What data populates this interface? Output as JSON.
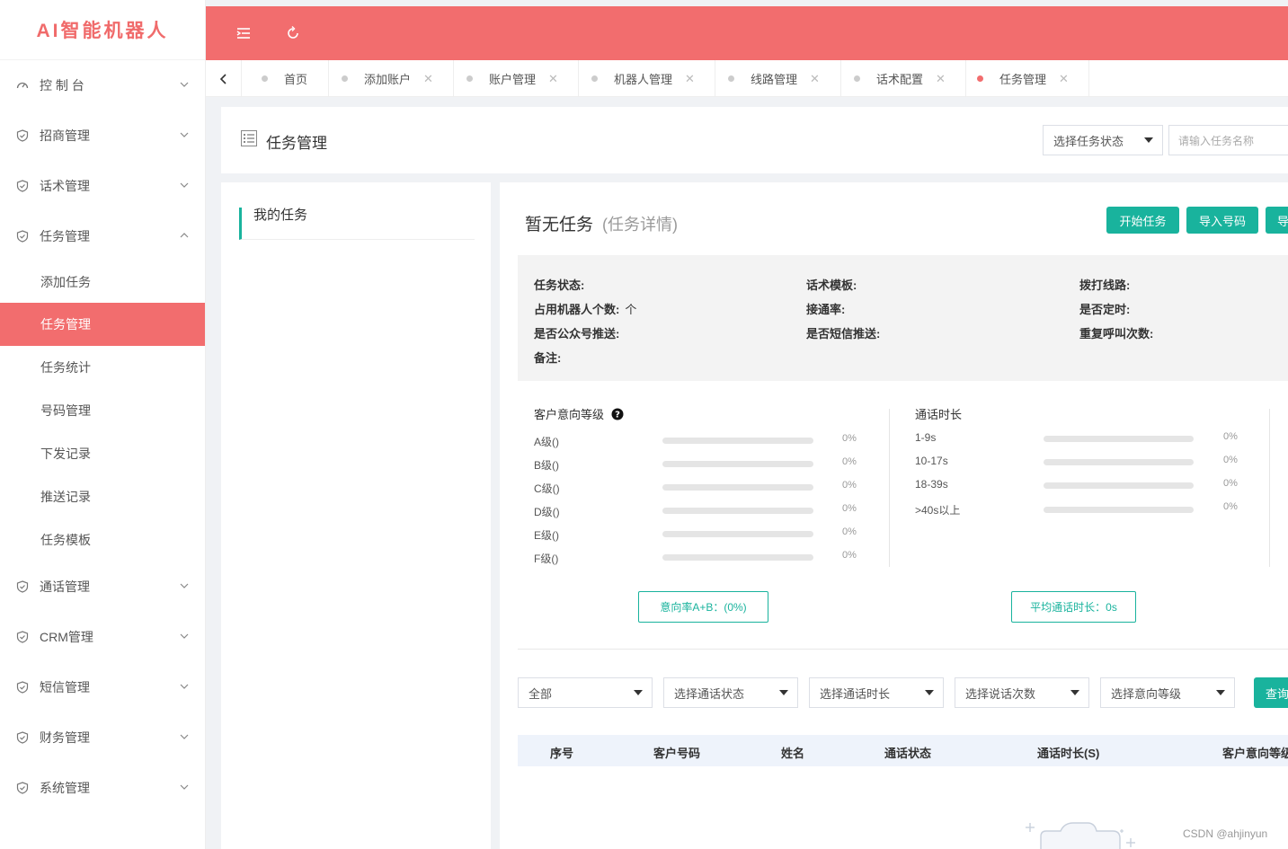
{
  "app": {
    "logo": "AI智能机器人"
  },
  "sidebar": {
    "items": [
      {
        "label": "控 制 台",
        "icon": "dashboard-icon",
        "expanded": false
      },
      {
        "label": "招商管理",
        "icon": "shield-icon",
        "expanded": false
      },
      {
        "label": "话术管理",
        "icon": "shield-icon",
        "expanded": false
      },
      {
        "label": "任务管理",
        "icon": "shield-icon",
        "expanded": true
      },
      {
        "label": "通话管理",
        "icon": "shield-icon",
        "expanded": false
      },
      {
        "label": "CRM管理",
        "icon": "shield-icon",
        "expanded": false
      },
      {
        "label": "短信管理",
        "icon": "shield-icon",
        "expanded": false
      },
      {
        "label": "财务管理",
        "icon": "shield-icon",
        "expanded": false
      },
      {
        "label": "系统管理",
        "icon": "shield-icon",
        "expanded": false
      }
    ],
    "task_sub": [
      "添加任务",
      "任务管理",
      "任务统计",
      "号码管理",
      "下发记录",
      "推送记录",
      "任务模板"
    ]
  },
  "topbar": {
    "menu_icon": "menu-fold-icon",
    "refresh_icon": "refresh-icon"
  },
  "tabs": [
    {
      "label": "首页",
      "closable": false
    },
    {
      "label": "添加账户",
      "closable": true
    },
    {
      "label": "账户管理",
      "closable": true
    },
    {
      "label": "机器人管理",
      "closable": true
    },
    {
      "label": "线路管理",
      "closable": true
    },
    {
      "label": "话术配置",
      "closable": true
    },
    {
      "label": "任务管理",
      "closable": true,
      "active": true
    }
  ],
  "page": {
    "title": "任务管理",
    "status_select": "选择任务状态",
    "name_placeholder": "请输入任务名称"
  },
  "left": {
    "my_tasks": "我的任务"
  },
  "main": {
    "title": "暂无任务",
    "subtitle": "(任务详情)",
    "buttons": [
      "开始任务",
      "导入号码",
      "导"
    ],
    "info": {
      "task_status": "任务状态:",
      "template": "话术模板:",
      "line": "拨打线路:",
      "robots": "占用机器人个数:",
      "robots_unit": "个",
      "connect_rate": "接通率:",
      "scheduled": "是否定时:",
      "wechat_push": "是否公众号推送:",
      "sms_push": "是否短信推送:",
      "retry": "重复呼叫次数:",
      "remark": "备注:"
    },
    "intent": {
      "title": "客户意向等级",
      "help_icon": "question-circle-icon",
      "rows": [
        {
          "label": "A级()",
          "pct": "0%"
        },
        {
          "label": "B级()",
          "pct": "0%"
        },
        {
          "label": "C级()",
          "pct": "0%"
        },
        {
          "label": "D级()",
          "pct": "0%"
        },
        {
          "label": "E级()",
          "pct": "0%"
        },
        {
          "label": "F级()",
          "pct": "0%"
        }
      ],
      "summary": "意向率A+B：(0%)"
    },
    "duration": {
      "title": "通话时长",
      "rows": [
        {
          "label": "1-9s",
          "pct": "0%"
        },
        {
          "label": "10-17s",
          "pct": "0%"
        },
        {
          "label": "18-39s",
          "pct": "0%"
        },
        {
          "label": ">40s以上",
          "pct": "0%"
        }
      ],
      "summary": "平均通话时长：0s"
    },
    "filters": [
      "全部",
      "选择通话状态",
      "选择通话时长",
      "选择说话次数",
      "选择意向等级"
    ],
    "query_button": "查询",
    "table_headers": [
      "序号",
      "客户号码",
      "姓名",
      "通话状态",
      "通话时长(S)",
      "客户意向等级"
    ]
  },
  "watermark": "CSDN @ahjinyun"
}
